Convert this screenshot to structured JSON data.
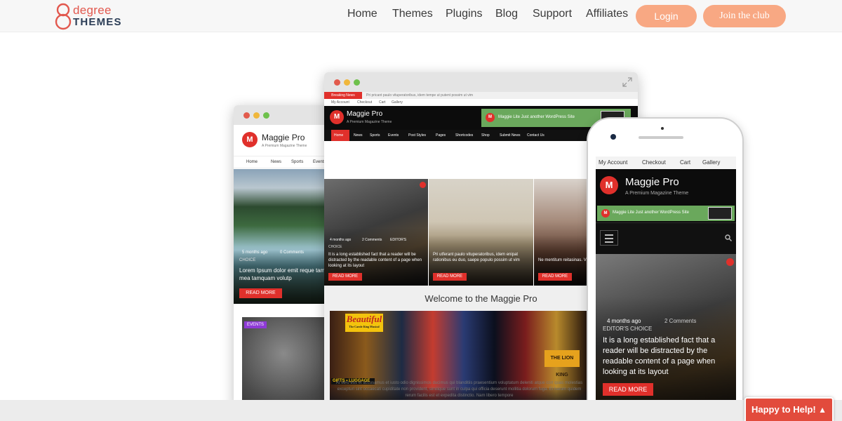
{
  "header": {
    "logo_degree": "degree",
    "logo_themes": "THEMES",
    "nav": [
      "Home",
      "Themes",
      "Plugins",
      "Blog",
      "Support",
      "Affiliates"
    ],
    "login_label": "Login",
    "join_label": "Join the club"
  },
  "left_mockup": {
    "site_title": "Maggie Pro",
    "tagline": "A Premium Magazine Theme",
    "menu": [
      "Home",
      "News",
      "Sports",
      "Events"
    ],
    "post_meta": "5 months ago",
    "post_comments": "0 Comments",
    "post_category": "CHOICE",
    "post_text": "Lorem Ipsum dolor emit reque tamquam, mea tamquam volutp",
    "read_more": "READ MORE",
    "badge_events": "EVENTS"
  },
  "center_mockup": {
    "breaking_label": "Breaking News",
    "breaking_text": "Pri pricant paulo vituperatoribus, idem tempe ut putent possim ut vim",
    "account_links": [
      "My Account",
      "Checkout",
      "Cart",
      "Gallery"
    ],
    "site_title": "Maggie Pro",
    "tagline": "A Premium Magazine Theme",
    "banner_text": "Maggie Lite Just another WordPress Site",
    "menu": [
      "Home",
      "News",
      "Sports",
      "Events",
      "Post Styles",
      "Pages",
      "Shortcodes",
      "Shop",
      "Submit News",
      "Contact Us"
    ],
    "card1_meta": "4 months ago",
    "card1_comments": "2 Comments",
    "card1_badge": "EDITOR'S",
    "card1_category": "CHOICE",
    "card1_text": "It is a long established fact that a reader will be distracted by the readable content of a page when looking at its layout",
    "card2_text": "Pri utferant paulo vituperatoribus, idem enipat rationibus eu duo, saepe populo possim ut vim",
    "card3_text": "Ne mentitum reitasinas. Vidit iure pertinax, semper",
    "read_more": "READ MORE",
    "welcome": "Welcome to the Maggie Pro",
    "body_text": "At vero eos et accusamus et iusto odio dignissimos ducimus qui blanditiis praesentium voluptatum deleniti atque corr quas molestias excepturi sint occaecati cupiditate non provident, similique sunt in culpa qui officia deserunt mollitia dolorum fuga. Et harum quidem rerum facilis est et expedita distinctio. Nam libero tempore",
    "sign_beautiful": "Beautiful",
    "sign_musical": "The Carole King Musical",
    "sign_gifts": "GIFTS • LUGGAGE",
    "sign_lion": "THE LION KING"
  },
  "phone_mockup": {
    "account_links": [
      "My Account",
      "Checkout",
      "Cart",
      "Gallery"
    ],
    "site_title": "Maggie Pro",
    "tagline": "A Premium Magazine Theme",
    "banner_text": "Maggie Lite Just another WordPress Site",
    "post_meta": "4 months ago",
    "post_comments": "2 Comments",
    "post_category": "EDITOR'S CHOICE",
    "post_text": "It is a long established fact that a reader will be distracted by the readable content of a page when looking at its layout",
    "read_more": "READ MORE"
  },
  "chat": {
    "label": "Happy to Help!"
  },
  "colors": {
    "accent_red": "#e0302b",
    "peach_button": "#f8a883",
    "help_red": "#e24b3c",
    "banner_green": "#6aa85c"
  }
}
